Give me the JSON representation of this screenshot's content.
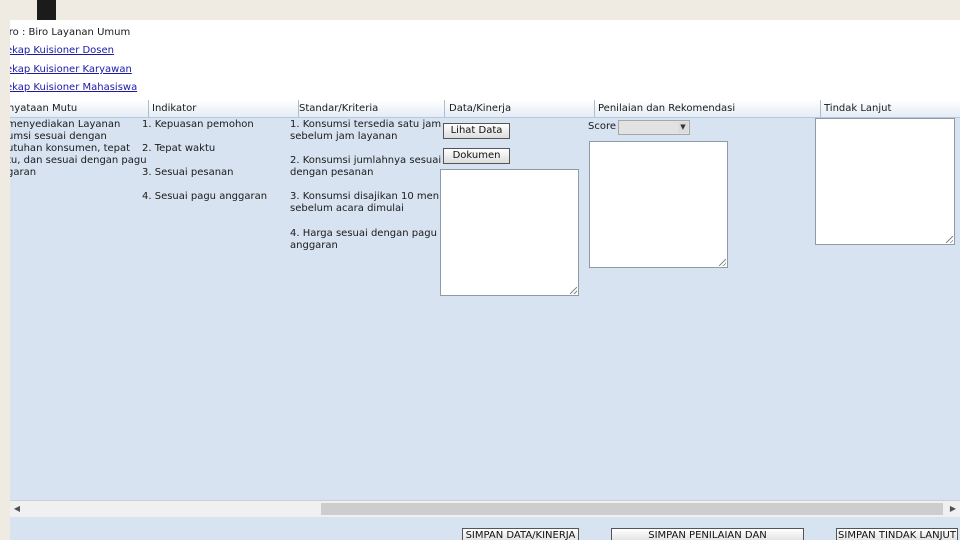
{
  "top": {
    "biro_label": "iro : Biro Layanan Umum",
    "links": [
      "ekap Kuisioner Dosen",
      "ekap Kuisioner Karyawan",
      "ekap Kuisioner Mahasiswa"
    ]
  },
  "table": {
    "headers": [
      "rnyataan Mutu",
      "Indikator",
      "Standar/Kriteria",
      "Data/Kinerja",
      "Penilaian dan Rekomendasi",
      "Tindak Lanjut"
    ],
    "pernyataan": "menyediakan Layanan\numsi sesuai dengan\nutuhan konsumen, tepat\ntu, dan sesuai dengan pagu\ngaran",
    "indikator": [
      "1. Kepuasan pemohon",
      "2. Tepat waktu",
      "3. Sesuai pesanan",
      "4. Sesuai pagu anggaran"
    ],
    "standar": [
      "1. Konsumsi tersedia satu jam\nsebelum jam layanan",
      "2. Konsumsi jumlahnya sesuai\ndengan pesanan",
      "3. Konsumsi disajikan 10 menit\nsebelum acara dimulai",
      "4. Harga sesuai dengan pagu\nanggaran"
    ]
  },
  "data_kinerja": {
    "lihat_data_label": "Lihat Data",
    "dokumen_label": "Dokumen"
  },
  "penilaian": {
    "score_label": "Score",
    "score_value": ""
  },
  "footer": {
    "save_data_label": "SIMPAN DATA/KINERJA",
    "save_penilaian_label": "SIMPAN PENILAIAN DAN REKOMENDASI",
    "save_tindak_label": "SIMPAN TINDAK LANJUT"
  }
}
